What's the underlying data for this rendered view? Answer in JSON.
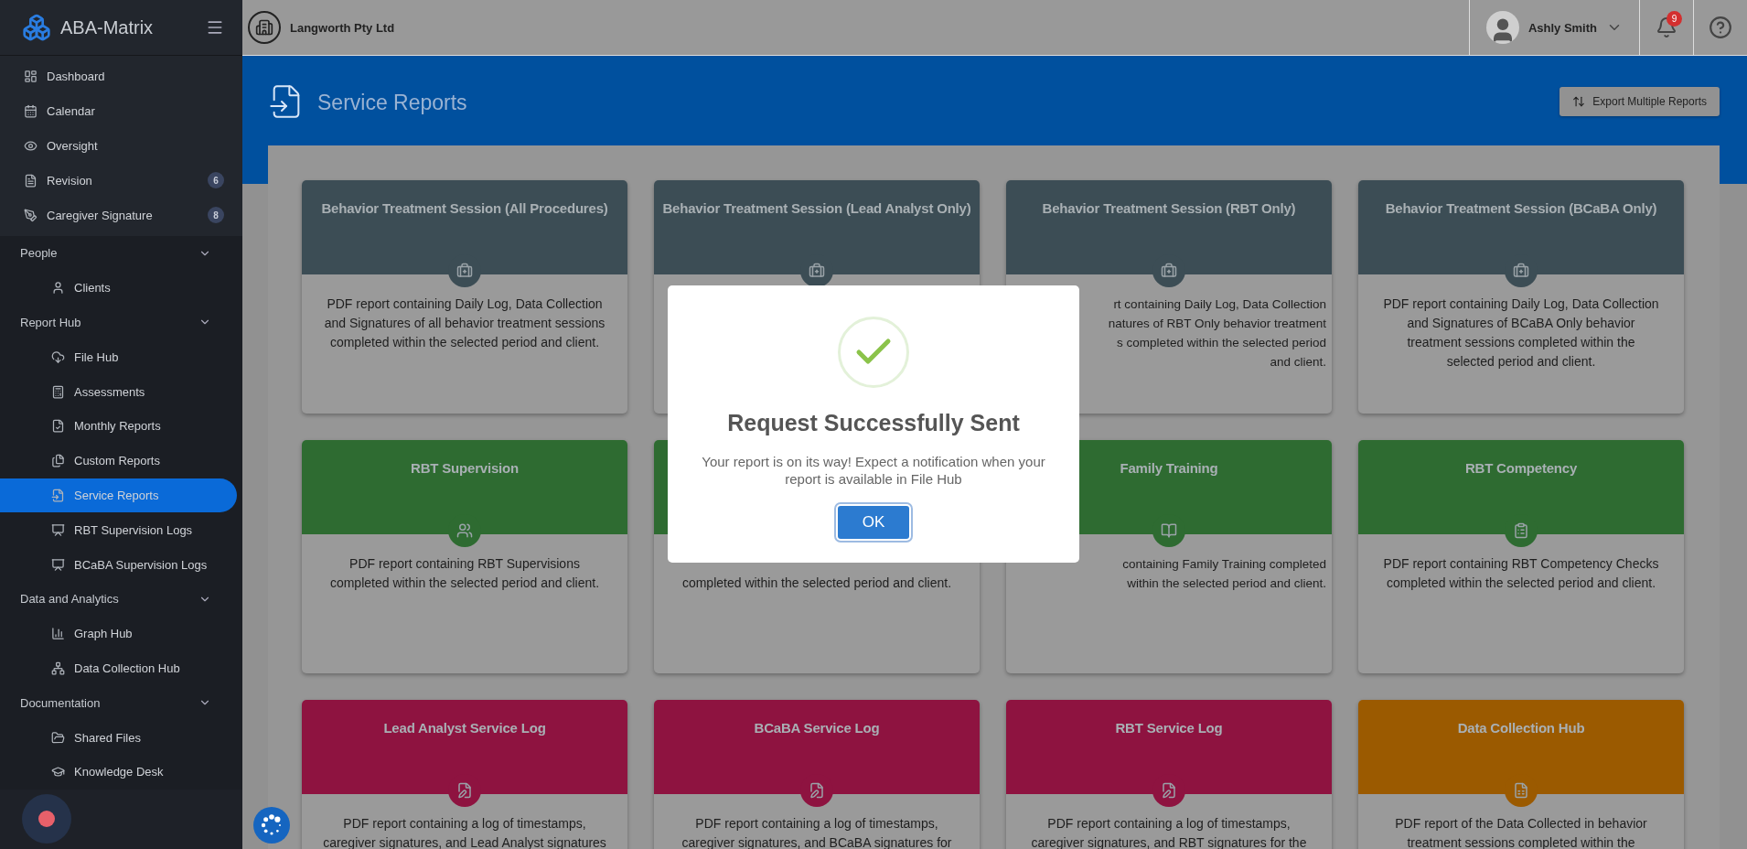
{
  "sidebar": {
    "brand": "ABA-Matrix",
    "items": [
      {
        "label": "Dashboard",
        "kind": "dashboard",
        "selected": false
      },
      {
        "label": "Calendar",
        "kind": "calendar",
        "selected": false
      },
      {
        "label": "Oversight",
        "kind": "eye",
        "selected": false
      },
      {
        "label": "Revision",
        "kind": "revision",
        "selected": false,
        "badge": "6"
      },
      {
        "label": "Caregiver Signature",
        "kind": "signature",
        "selected": false,
        "badge": "8"
      }
    ],
    "sections": [
      {
        "title": "People",
        "expanded": true,
        "children": [
          {
            "label": "Clients",
            "kind": "user",
            "selected": false
          }
        ]
      },
      {
        "title": "Report Hub",
        "expanded": true,
        "children": [
          {
            "label": "File Hub",
            "kind": "cloud",
            "selected": false
          },
          {
            "label": "Assessments",
            "kind": "calc",
            "selected": false
          },
          {
            "label": "Monthly Reports",
            "kind": "monthly",
            "selected": false
          },
          {
            "label": "Custom Reports",
            "kind": "custom",
            "selected": false
          },
          {
            "label": "Service Reports",
            "kind": "service",
            "selected": true
          },
          {
            "label": "RBT Supervision Logs",
            "kind": "monitor",
            "selected": false
          },
          {
            "label": "BCaBA Supervision Logs",
            "kind": "monitor",
            "selected": false
          }
        ]
      },
      {
        "title": "Data and Analytics",
        "expanded": true,
        "children": [
          {
            "label": "Graph Hub",
            "kind": "graph",
            "selected": false
          },
          {
            "label": "Data Collection Hub",
            "kind": "network",
            "selected": false
          }
        ]
      },
      {
        "title": "Documentation",
        "expanded": true,
        "children": [
          {
            "label": "Shared Files",
            "kind": "shared",
            "selected": false
          },
          {
            "label": "Knowledge Desk",
            "kind": "cap",
            "selected": false
          }
        ]
      }
    ]
  },
  "header": {
    "company": "Langworth Pty Ltd",
    "user": "Ashly Smith",
    "notifications": "9"
  },
  "page": {
    "title": "Service Reports",
    "export_button": "Export Multiple Reports"
  },
  "cards": [
    {
      "title": "Behavior Treatment Session (All Procedures)",
      "kind": "treatment",
      "color": "#3c4d55",
      "description": [
        "PDF report containing Daily Log, Data Collection",
        "and Signatures of all behavior treatment sessions",
        "completed within the selected period and client."
      ]
    },
    {
      "title": "Behavior Treatment Session (Lead Analyst Only)",
      "kind": "treatment",
      "color": "#3c4d55"
    },
    {
      "title": "Behavior Treatment Session (RBT Only)",
      "kind": "treatment",
      "color": "#3c4d55",
      "description_fragments": [
        "rt containing Daily Log, Data Collection",
        "natures of RBT Only behavior treatment",
        "s completed within the selected period",
        "and client."
      ]
    },
    {
      "title": "Behavior Treatment Session (BCaBA Only)",
      "kind": "treatment",
      "color": "#3c4d55",
      "description": [
        "PDF report containing Daily Log, Data Collection",
        "and Signatures of BCaBA Only behavior",
        "treatment sessions completed within the",
        "selected period and client."
      ]
    },
    {
      "title": "RBT Supervision",
      "kind": "supervision",
      "color": "#2e6b31",
      "description": [
        "PDF report containing RBT Supervisions",
        "completed within the selected period and client."
      ]
    },
    {
      "kind": "supervision",
      "color": "#2e6b31",
      "description": [
        "completed within the selected period and client."
      ]
    },
    {
      "title": "Family Training",
      "kind": "training",
      "color": "#2e6b31",
      "description_fragments": [
        "containing Family Training completed",
        "within the selected period and client."
      ]
    },
    {
      "title": "RBT Competency",
      "kind": "competency",
      "color": "#2e6b31",
      "description": [
        "PDF report containing RBT Competency Checks",
        "completed within the selected period and client."
      ]
    },
    {
      "title": "Lead Analyst Service Log",
      "kind": "log",
      "color": "#8e1340",
      "description": [
        "PDF report containing a log of timestamps,",
        "caregiver signatures, and Lead Analyst signatures"
      ]
    },
    {
      "title": "BCaBA Service Log",
      "kind": "log",
      "color": "#8e1340",
      "description": [
        "PDF report containing a log of timestamps,",
        "caregiver signatures, and BCaBA signatures for"
      ]
    },
    {
      "title": "RBT Service Log",
      "kind": "log",
      "color": "#8e1340",
      "description": [
        "PDF report containing a log of timestamps,",
        "caregiver signatures, and RBT signatures for the"
      ]
    },
    {
      "title": "Data Collection Hub",
      "kind": "data",
      "color": "#9b5a00",
      "description": [
        "PDF report of the Data Collected in behavior",
        "treatment sessions completed within the"
      ]
    }
  ],
  "dialog": {
    "title": "Request Successfully Sent",
    "message": "Your report is on its way! Expect a notification when your report is available in File Hub",
    "button": "OK"
  }
}
